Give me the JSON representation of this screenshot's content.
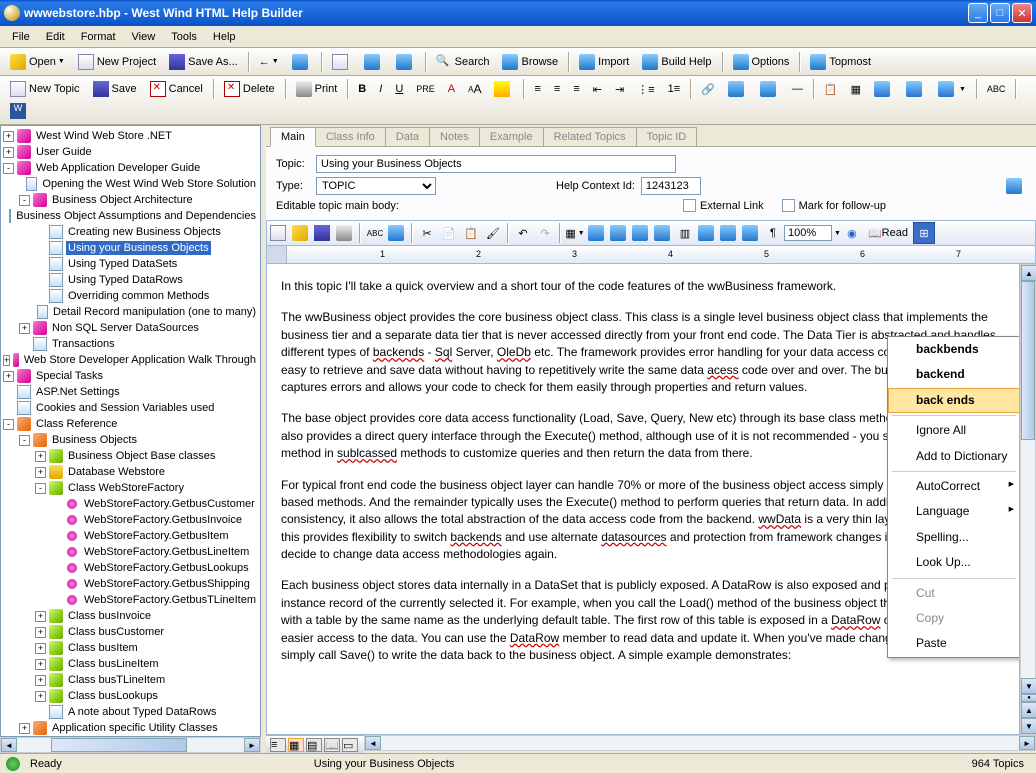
{
  "window": {
    "title": "wwwebstore.hbp - West Wind HTML Help Builder"
  },
  "menubar": [
    "File",
    "Edit",
    "Format",
    "View",
    "Tools",
    "Help"
  ],
  "toolbar1": {
    "open": "Open",
    "new_project": "New Project",
    "save_as": "Save As...",
    "search": "Search",
    "browse": "Browse",
    "import": "Import",
    "build_help": "Build Help",
    "options": "Options",
    "topmost": "Topmost"
  },
  "toolbar2": {
    "new_topic": "New Topic",
    "save": "Save",
    "cancel": "Cancel",
    "delete": "Delete",
    "print": "Print"
  },
  "tree": [
    {
      "d": 0,
      "t": "+",
      "i": "book",
      "l": "West Wind Web Store .NET"
    },
    {
      "d": 0,
      "t": "+",
      "i": "book",
      "l": "User Guide"
    },
    {
      "d": 0,
      "t": "-",
      "i": "book",
      "l": "Web Application Developer Guide"
    },
    {
      "d": 1,
      "t": " ",
      "i": "page",
      "l": "Opening the West Wind Web Store Solution"
    },
    {
      "d": 1,
      "t": "-",
      "i": "book",
      "l": "Business Object Architecture"
    },
    {
      "d": 2,
      "t": " ",
      "i": "page",
      "l": "Business Object Assumptions and Dependencies"
    },
    {
      "d": 2,
      "t": " ",
      "i": "page",
      "l": "Creating new Business Objects"
    },
    {
      "d": 2,
      "t": " ",
      "i": "page",
      "l": "Using your Business Objects",
      "sel": true
    },
    {
      "d": 2,
      "t": " ",
      "i": "page",
      "l": "Using Typed DataSets"
    },
    {
      "d": 2,
      "t": " ",
      "i": "page",
      "l": "Using Typed DataRows"
    },
    {
      "d": 2,
      "t": " ",
      "i": "page",
      "l": "Overriding common Methods"
    },
    {
      "d": 2,
      "t": " ",
      "i": "page",
      "l": "Detail Record manipulation (one to many)"
    },
    {
      "d": 1,
      "t": "+",
      "i": "book",
      "l": "Non SQL Server DataSources"
    },
    {
      "d": 1,
      "t": " ",
      "i": "page",
      "l": "Transactions"
    },
    {
      "d": 0,
      "t": "+",
      "i": "book",
      "l": "Web Store Developer Application Walk Through"
    },
    {
      "d": 0,
      "t": "+",
      "i": "book",
      "l": "Special Tasks"
    },
    {
      "d": 0,
      "t": " ",
      "i": "page",
      "l": "ASP.Net Settings"
    },
    {
      "d": 0,
      "t": " ",
      "i": "page",
      "l": "Cookies and Session Variables used"
    },
    {
      "d": 0,
      "t": "-",
      "i": "book2",
      "l": "Class Reference"
    },
    {
      "d": 1,
      "t": "-",
      "i": "book2",
      "l": "Business Objects"
    },
    {
      "d": 2,
      "t": "+",
      "i": "class",
      "l": "Business Object Base classes"
    },
    {
      "d": 2,
      "t": "+",
      "i": "db",
      "l": "Database Webstore"
    },
    {
      "d": 2,
      "t": "-",
      "i": "class",
      "l": "Class WebStoreFactory"
    },
    {
      "d": 3,
      "t": " ",
      "i": "method",
      "l": "WebStoreFactory.GetbusCustomer"
    },
    {
      "d": 3,
      "t": " ",
      "i": "method",
      "l": "WebStoreFactory.GetbusInvoice"
    },
    {
      "d": 3,
      "t": " ",
      "i": "method",
      "l": "WebStoreFactory.GetbusItem"
    },
    {
      "d": 3,
      "t": " ",
      "i": "method",
      "l": "WebStoreFactory.GetbusLineItem"
    },
    {
      "d": 3,
      "t": " ",
      "i": "method",
      "l": "WebStoreFactory.GetbusLookups"
    },
    {
      "d": 3,
      "t": " ",
      "i": "method",
      "l": "WebStoreFactory.GetbusShipping"
    },
    {
      "d": 3,
      "t": " ",
      "i": "method",
      "l": "WebStoreFactory.GetbusTLineItem"
    },
    {
      "d": 2,
      "t": "+",
      "i": "class",
      "l": "Class busInvoice"
    },
    {
      "d": 2,
      "t": "+",
      "i": "class",
      "l": "Class busCustomer"
    },
    {
      "d": 2,
      "t": "+",
      "i": "class",
      "l": "Class busItem"
    },
    {
      "d": 2,
      "t": "+",
      "i": "class",
      "l": "Class busLineItem"
    },
    {
      "d": 2,
      "t": "+",
      "i": "class",
      "l": "Class busTLineItem"
    },
    {
      "d": 2,
      "t": "+",
      "i": "class",
      "l": "Class busLookups"
    },
    {
      "d": 2,
      "t": " ",
      "i": "page",
      "l": "A note about Typed DataRows"
    },
    {
      "d": 1,
      "t": "+",
      "i": "book2",
      "l": "Application specific Utility Classes"
    }
  ],
  "tabs": [
    "Main",
    "Class Info",
    "Data",
    "Notes",
    "Example",
    "Related Topics",
    "Topic ID"
  ],
  "form": {
    "topic_label": "Topic:",
    "topic_value": "Using your Business Objects",
    "type_label": "Type:",
    "type_value": "TOPIC",
    "help_ctx_label": "Help Context Id:",
    "help_ctx_value": "1243123",
    "editable_label": "Editable topic main body:",
    "external_link": "External Link",
    "mark_followup": "Mark for follow-up"
  },
  "editor": {
    "zoom": "100%",
    "read": "Read",
    "para1": "In this topic I'll take a quick overview and a short tour of the code features of the wwBusiness framework.",
    "para2_a": "The wwBusiness object provides the core business object class. This class is a single level business object class that implements the business tier and a separate data tier that is never accessed directly from your front end code. The Data Tier is abstracted and handles different types of ",
    "para2_sq1": "backends",
    "para2_b": " - ",
    "para2_sq2": "Sql",
    "para2_c": " Server, ",
    "para2_sq3": "OleDb",
    "para2_d": " etc. The framework provides error handling for your data access code and makes it very easy to retrieve and save data without having to repetitively write the same data ",
    "para2_sq4": "acess",
    "para2_e": " code over and over. The built in error handling captures errors and allows your code to check for them easily through properties and return values.",
    "para3_a": "The base object provides core data access functionality (Load, Save, Query, New etc) through its base class methods. The base class also provides a direct query interface through the Execute() method, although use of it is not recommended - you should use this method in ",
    "para3_sq1": "sublcassed",
    "para3_b": " methods to customize queries and then return the data from there.",
    "para4_a": "For typical front end code the business object layer can handle 70% or more of the business object access simply by using the record based methods. And the remainder typically uses the Execute() method to perform queries that return data. In addition to providing this consistency, it also allows the total abstraction of the data access code from the backend. ",
    "para4_sq1": "wwData",
    "para4_b": " is a very thin layer over ADO.Net, but this provides flexibility to switch ",
    "para4_sq2": "backends",
    "para4_c": " and use alternate ",
    "para4_sq3": "datasources",
    "para4_d": " and protection from framework changes if Microsoft should decide to change data access methodologies again.",
    "para5_a": "Each business object stores data internally in a DataSet that is publicly exposed. A DataRow is also exposed and provides a 'current' instance record of the currently selected it. For example, when you call the Load() method of the business object the DataSet is loaded with a table by the same name as the underlying default table. The first row of this table is exposed in a ",
    "para5_sq1": "DataRow",
    "para5_b": " object which provides easier access to the data. You can use the ",
    "para5_sq2": "DataRow",
    "para5_c": " member to read data and update it. When you've made changes to it you can simply call Save() to write the data back to the business object. A simple example demonstrates:"
  },
  "context_menu": {
    "s1": "backbends",
    "s2": "backend",
    "s3": "back ends",
    "ignore": "Ignore All",
    "add": "Add to Dictionary",
    "auto": "AutoCorrect",
    "lang": "Language",
    "spell": "Spelling...",
    "look": "Look Up...",
    "cut": "Cut",
    "copy": "Copy",
    "paste": "Paste"
  },
  "status": {
    "ready": "Ready",
    "current": "Using your Business Objects",
    "topics": "964 Topics"
  }
}
